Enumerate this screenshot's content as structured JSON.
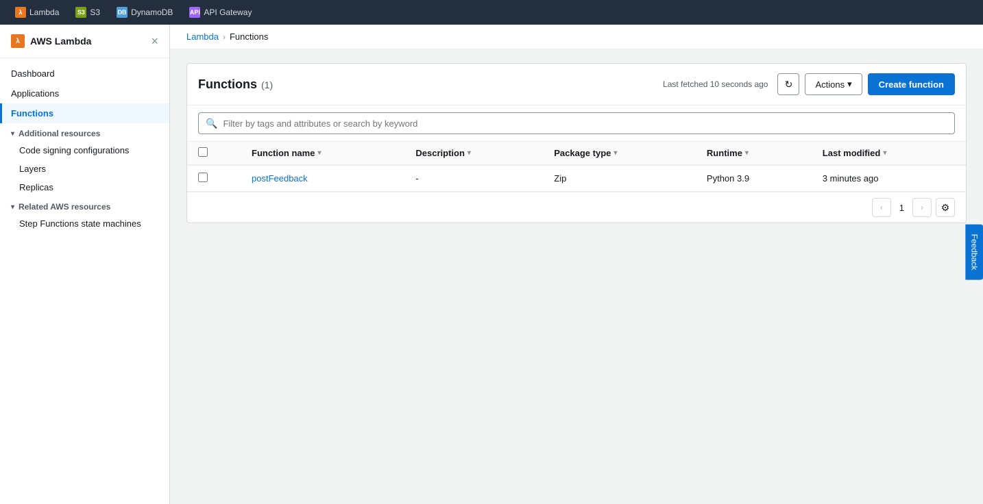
{
  "app": {
    "title": "AWS Lambda"
  },
  "service_bar": {
    "tabs": [
      {
        "id": "lambda",
        "label": "Lambda",
        "icon_type": "lambda",
        "icon_text": "λ"
      },
      {
        "id": "s3",
        "label": "S3",
        "icon_type": "s3",
        "icon_text": "S3"
      },
      {
        "id": "dynamodb",
        "label": "DynamoDB",
        "icon_type": "dynamo",
        "icon_text": "DB"
      },
      {
        "id": "api-gateway",
        "label": "API Gateway",
        "icon_type": "api",
        "icon_text": "API"
      }
    ]
  },
  "sidebar": {
    "title": "AWS Lambda",
    "close_label": "×",
    "nav_items": [
      {
        "id": "dashboard",
        "label": "Dashboard",
        "active": false
      },
      {
        "id": "applications",
        "label": "Applications",
        "active": false
      },
      {
        "id": "functions",
        "label": "Functions",
        "active": true
      }
    ],
    "sections": [
      {
        "id": "additional-resources",
        "label": "Additional resources",
        "items": [
          {
            "id": "code-signing",
            "label": "Code signing configurations"
          },
          {
            "id": "layers",
            "label": "Layers"
          },
          {
            "id": "replicas",
            "label": "Replicas"
          }
        ]
      },
      {
        "id": "related-aws-resources",
        "label": "Related AWS resources",
        "items": [
          {
            "id": "step-functions",
            "label": "Step Functions state machines"
          }
        ]
      }
    ]
  },
  "breadcrumb": {
    "items": [
      {
        "id": "lambda-link",
        "label": "Lambda",
        "link": true
      },
      {
        "id": "sep",
        "label": "›"
      },
      {
        "id": "functions-current",
        "label": "Functions"
      }
    ]
  },
  "functions_table": {
    "title": "Functions",
    "count_label": "(1)",
    "last_fetched": "Last fetched 10 seconds ago",
    "refresh_icon": "↻",
    "actions_label": "Actions",
    "actions_chevron": "▾",
    "create_function_label": "Create function",
    "search_placeholder": "Filter by tags and attributes or search by keyword",
    "columns": [
      {
        "id": "function-name",
        "label": "Function name"
      },
      {
        "id": "description",
        "label": "Description"
      },
      {
        "id": "package-type",
        "label": "Package type"
      },
      {
        "id": "runtime",
        "label": "Runtime"
      },
      {
        "id": "last-modified",
        "label": "Last modified"
      }
    ],
    "rows": [
      {
        "id": "postfeedback-row",
        "function_name": "postFeedback",
        "description": "-",
        "package_type": "Zip",
        "runtime": "Python 3.9",
        "last_modified": "3 minutes ago"
      }
    ],
    "pagination": {
      "prev_disabled": true,
      "current_page": "1",
      "next_disabled": true
    }
  },
  "feedback": {
    "label": "Feedback"
  }
}
